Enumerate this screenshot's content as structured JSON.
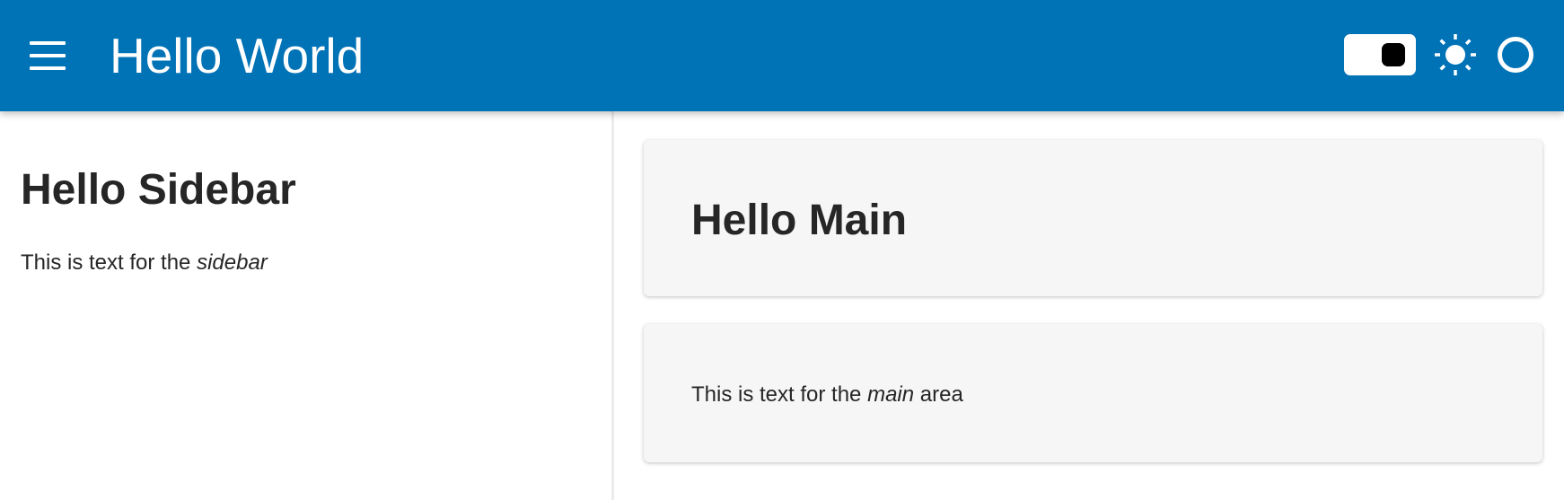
{
  "header": {
    "title": "Hello World",
    "menu_icon": "hamburger-menu-icon",
    "theme_toggle_icon": "toggle-switch-icon",
    "light_mode_icon": "sun-icon",
    "contrast_icon": "circle-icon",
    "background_color": "#0072b6"
  },
  "sidebar": {
    "heading": "Hello Sidebar",
    "text_prefix": "This is text for the ",
    "text_emphasis": "sidebar"
  },
  "main": {
    "heading": "Hello Main",
    "text_prefix": "This is text for the ",
    "text_emphasis": "main",
    "text_suffix": " area",
    "card_background": "#f6f6f6"
  }
}
